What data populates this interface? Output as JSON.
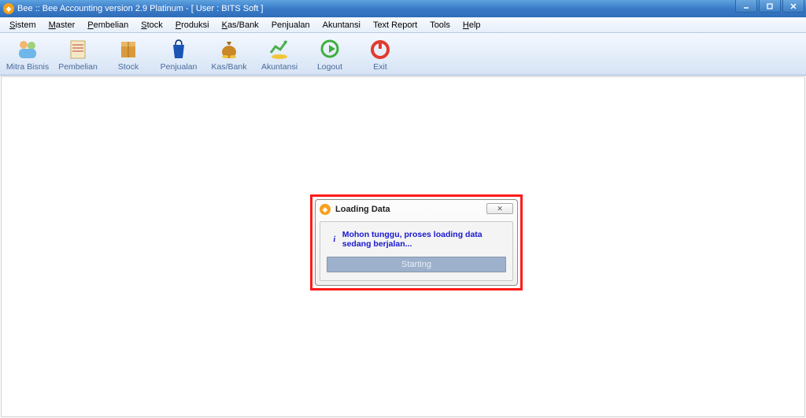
{
  "window": {
    "title": "Bee :: Bee Accounting version 2.9 Platinum -    [ User : BITS Soft ]"
  },
  "menu": [
    {
      "label": "Sistem",
      "hotkey": "S",
      "rest": "istem"
    },
    {
      "label": "Master",
      "hotkey": "M",
      "rest": "aster"
    },
    {
      "label": "Pembelian",
      "hotkey": "P",
      "rest": "embelian"
    },
    {
      "label": "Stock",
      "hotkey": "S",
      "rest": "tock"
    },
    {
      "label": "Produksi",
      "hotkey": "P",
      "rest": "roduksi"
    },
    {
      "label": "Kas/Bank",
      "hotkey": "K",
      "rest": "as/Bank"
    },
    {
      "label": "Penjualan",
      "hotkey": "",
      "rest": "Penjualan"
    },
    {
      "label": "Akuntansi",
      "hotkey": "",
      "rest": "Akuntansi"
    },
    {
      "label": "Text Report",
      "hotkey": "",
      "rest": "Text Report"
    },
    {
      "label": "Tools",
      "hotkey": "",
      "rest": "Tools"
    },
    {
      "label": "Help",
      "hotkey": "H",
      "rest": "elp"
    }
  ],
  "toolbar": [
    {
      "name": "mitra-bisnis",
      "label": "Mitra Bisnis"
    },
    {
      "name": "pembelian",
      "label": "Pembelian"
    },
    {
      "name": "stock",
      "label": "Stock"
    },
    {
      "name": "penjualan",
      "label": "Penjualan"
    },
    {
      "name": "kasbank",
      "label": "Kas/Bank"
    },
    {
      "name": "akuntansi",
      "label": "Akuntansi"
    },
    {
      "name": "logout",
      "label": "Logout"
    },
    {
      "name": "exit",
      "label": "Exit"
    }
  ],
  "dialog": {
    "title": "Loading Data",
    "close_glyph": "✕",
    "message": "Mohon tunggu, proses loading data sedang berjalan...",
    "progress_text": "Starting"
  }
}
